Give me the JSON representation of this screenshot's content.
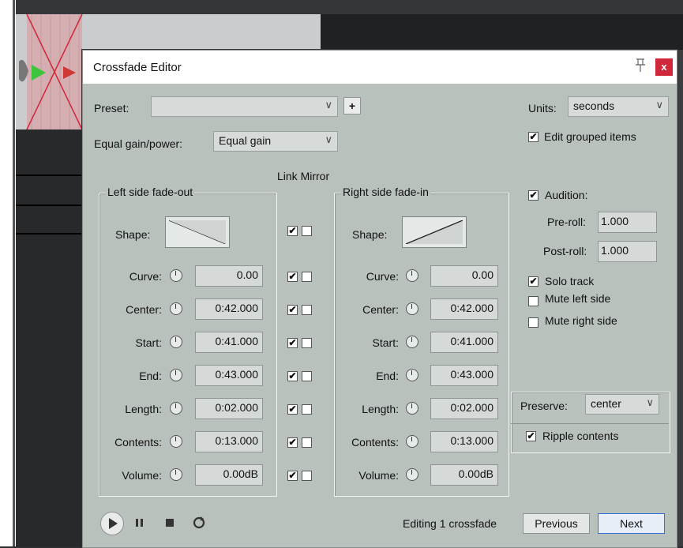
{
  "dialog": {
    "title": "Crossfade Editor",
    "close_glyph": "x",
    "pin_icon": "pin-icon"
  },
  "preset": {
    "label": "Preset:",
    "value": "",
    "add_label": "+"
  },
  "units": {
    "label": "Units:",
    "value": "seconds"
  },
  "equal_gain": {
    "label": "Equal gain/power:",
    "value": "Equal gain"
  },
  "edit_grouped": {
    "label": "Edit grouped items",
    "checked": true
  },
  "link_mirror_label": "Link Mirror",
  "left": {
    "title": "Left side fade-out",
    "shape_label": "Shape:",
    "rows": [
      {
        "label": "Curve:",
        "value": "0.00"
      },
      {
        "label": "Center:",
        "value": "0:42.000"
      },
      {
        "label": "Start:",
        "value": "0:41.000"
      },
      {
        "label": "End:",
        "value": "0:43.000"
      },
      {
        "label": "Length:",
        "value": "0:02.000"
      },
      {
        "label": "Contents:",
        "value": "0:13.000"
      },
      {
        "label": "Volume:",
        "value": "0.00dB"
      }
    ]
  },
  "right": {
    "title": "Right side fade-in",
    "shape_label": "Shape:",
    "rows": [
      {
        "label": "Curve:",
        "value": "0.00"
      },
      {
        "label": "Center:",
        "value": "0:42.000"
      },
      {
        "label": "Start:",
        "value": "0:41.000"
      },
      {
        "label": "End:",
        "value": "0:43.000"
      },
      {
        "label": "Length:",
        "value": "0:02.000"
      },
      {
        "label": "Contents:",
        "value": "0:13.000"
      },
      {
        "label": "Volume:",
        "value": "0.00dB"
      }
    ]
  },
  "audition": {
    "label": "Audition:",
    "checked": true,
    "preroll_label": "Pre-roll:",
    "preroll_value": "1.000",
    "postroll_label": "Post-roll:",
    "postroll_value": "1.000"
  },
  "solo_track": {
    "label": "Solo track",
    "checked": true
  },
  "mute_left": {
    "label": "Mute left side",
    "checked": false
  },
  "mute_right": {
    "label": "Mute right side",
    "checked": false
  },
  "preserve": {
    "label": "Preserve:",
    "value": "center"
  },
  "ripple": {
    "label": "Ripple contents",
    "checked": true
  },
  "status": "Editing 1 crossfade",
  "buttons": {
    "previous": "Previous",
    "next": "Next"
  },
  "check_glyph": "✔",
  "transport_icons": [
    "play-icon",
    "pause-icon",
    "stop-icon",
    "loop-icon"
  ],
  "colors": {
    "dialog_bg": "#b9c1bd",
    "close_bg": "#d0283a",
    "next_border": "#2f6fd6"
  }
}
